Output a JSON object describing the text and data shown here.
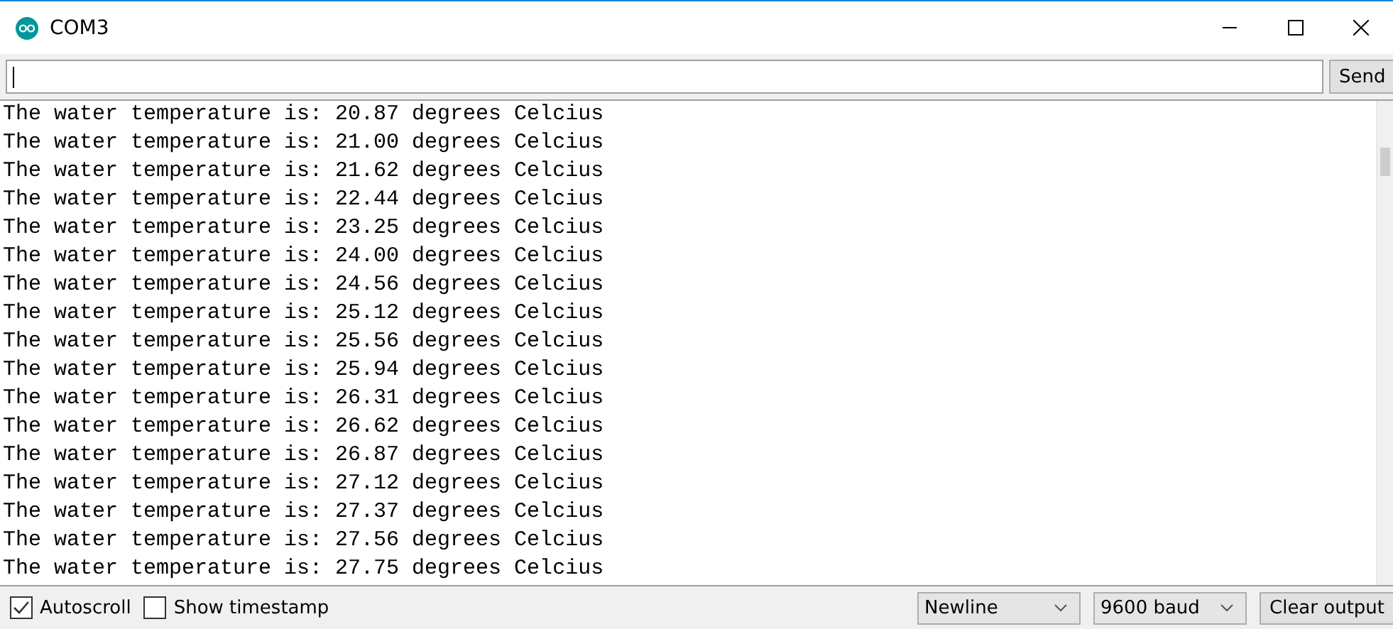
{
  "window": {
    "title": "COM3"
  },
  "send_button": "Send",
  "output_lines": [
    "The water temperature is: 20.87 degrees Celcius",
    "The water temperature is: 21.00 degrees Celcius",
    "The water temperature is: 21.62 degrees Celcius",
    "The water temperature is: 22.44 degrees Celcius",
    "The water temperature is: 23.25 degrees Celcius",
    "The water temperature is: 24.00 degrees Celcius",
    "The water temperature is: 24.56 degrees Celcius",
    "The water temperature is: 25.12 degrees Celcius",
    "The water temperature is: 25.56 degrees Celcius",
    "The water temperature is: 25.94 degrees Celcius",
    "The water temperature is: 26.31 degrees Celcius",
    "The water temperature is: 26.62 degrees Celcius",
    "The water temperature is: 26.87 degrees Celcius",
    "The water temperature is: 27.12 degrees Celcius",
    "The water temperature is: 27.37 degrees Celcius",
    "The water temperature is: 27.56 degrees Celcius",
    "The water temperature is: 27.75 degrees Celcius"
  ],
  "checkboxes": [
    {
      "label": "Autoscroll",
      "checked": true
    },
    {
      "label": "Show timestamp",
      "checked": false
    }
  ],
  "line_ending": "Newline",
  "baud_rate": "9600 baud",
  "clear_button": "Clear output"
}
